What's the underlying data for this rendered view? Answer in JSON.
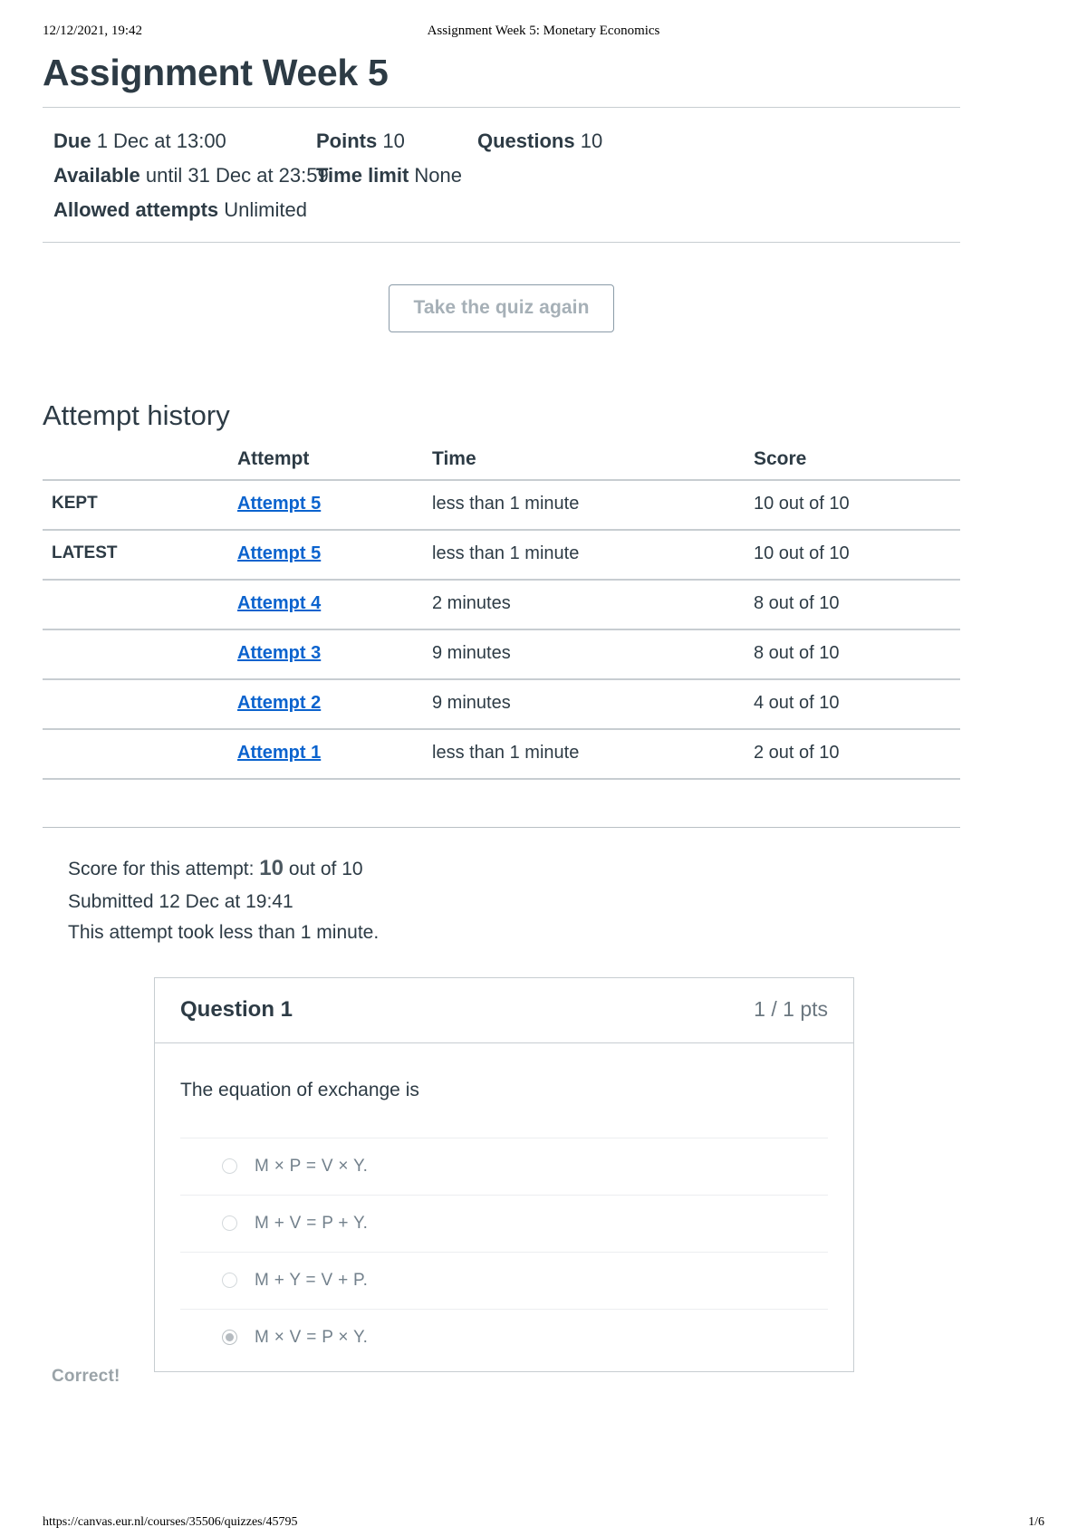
{
  "print_header": {
    "timestamp": "12/12/2021, 19:42",
    "doc_title": "Assignment Week 5: Monetary Economics"
  },
  "print_footer": {
    "url": "https://canvas.eur.nl/courses/35506/quizzes/45795",
    "page": "1/6"
  },
  "page_title": "Assignment Week 5",
  "meta": {
    "due_label": "Due",
    "due_value": "1 Dec at 13:00",
    "points_label": "Points",
    "points_value": "10",
    "questions_label": "Questions",
    "questions_value": "10",
    "available_label": "Available",
    "available_value": "until 31 Dec at 23:59",
    "time_limit_label": "Time limit",
    "time_limit_value": "None",
    "allowed_attempts_label": "Allowed attempts",
    "allowed_attempts_value": "Unlimited"
  },
  "take_again_button": "Take the quiz again",
  "attempt_history": {
    "heading": "Attempt history",
    "columns": {
      "flag": "",
      "attempt": "Attempt",
      "time": "Time",
      "score": "Score"
    },
    "rows": [
      {
        "flag": "KEPT",
        "attempt": "Attempt 5 ",
        "time": "less than 1 minute",
        "score": "10 out of 10"
      },
      {
        "flag": "LATEST",
        "attempt": "Attempt 5 ",
        "time": "less than 1 minute",
        "score": "10 out of 10"
      },
      {
        "flag": "",
        "attempt": "Attempt 4 ",
        "time": "2 minutes",
        "score": "8 out of 10"
      },
      {
        "flag": "",
        "attempt": "Attempt 3 ",
        "time": "9 minutes",
        "score": "8 out of 10"
      },
      {
        "flag": "",
        "attempt": "Attempt 2 ",
        "time": "9 minutes",
        "score": "4 out of 10"
      },
      {
        "flag": "",
        "attempt": "Attempt 1 ",
        "time": "less than 1 minute",
        "score": "2 out of 10"
      }
    ]
  },
  "attempt_summary": {
    "score_prefix": "Score for this attempt:",
    "score_value": "10",
    "score_suffix": "out of 10",
    "submitted": "Submitted 12 Dec at 19:41",
    "duration": "This attempt took less than 1 minute."
  },
  "question": {
    "name": "Question 1",
    "points": "1 / 1 pts",
    "prompt": "The equation of exchange is",
    "correct_flag": "Correct!",
    "answers": [
      {
        "text": "M × P = V × Y.",
        "selected": false
      },
      {
        "text": "M + V = P + Y.",
        "selected": false
      },
      {
        "text": "M + Y = V + P.",
        "selected": false
      },
      {
        "text": "M × V = P × Y.",
        "selected": true
      }
    ]
  },
  "colors": {
    "link": "#0b63ce",
    "text": "#2d3b45",
    "muted": "#73818c",
    "rule": "#c7cdd1",
    "button_border": "#8a9ba8",
    "button_text": "#a6b0b7"
  }
}
